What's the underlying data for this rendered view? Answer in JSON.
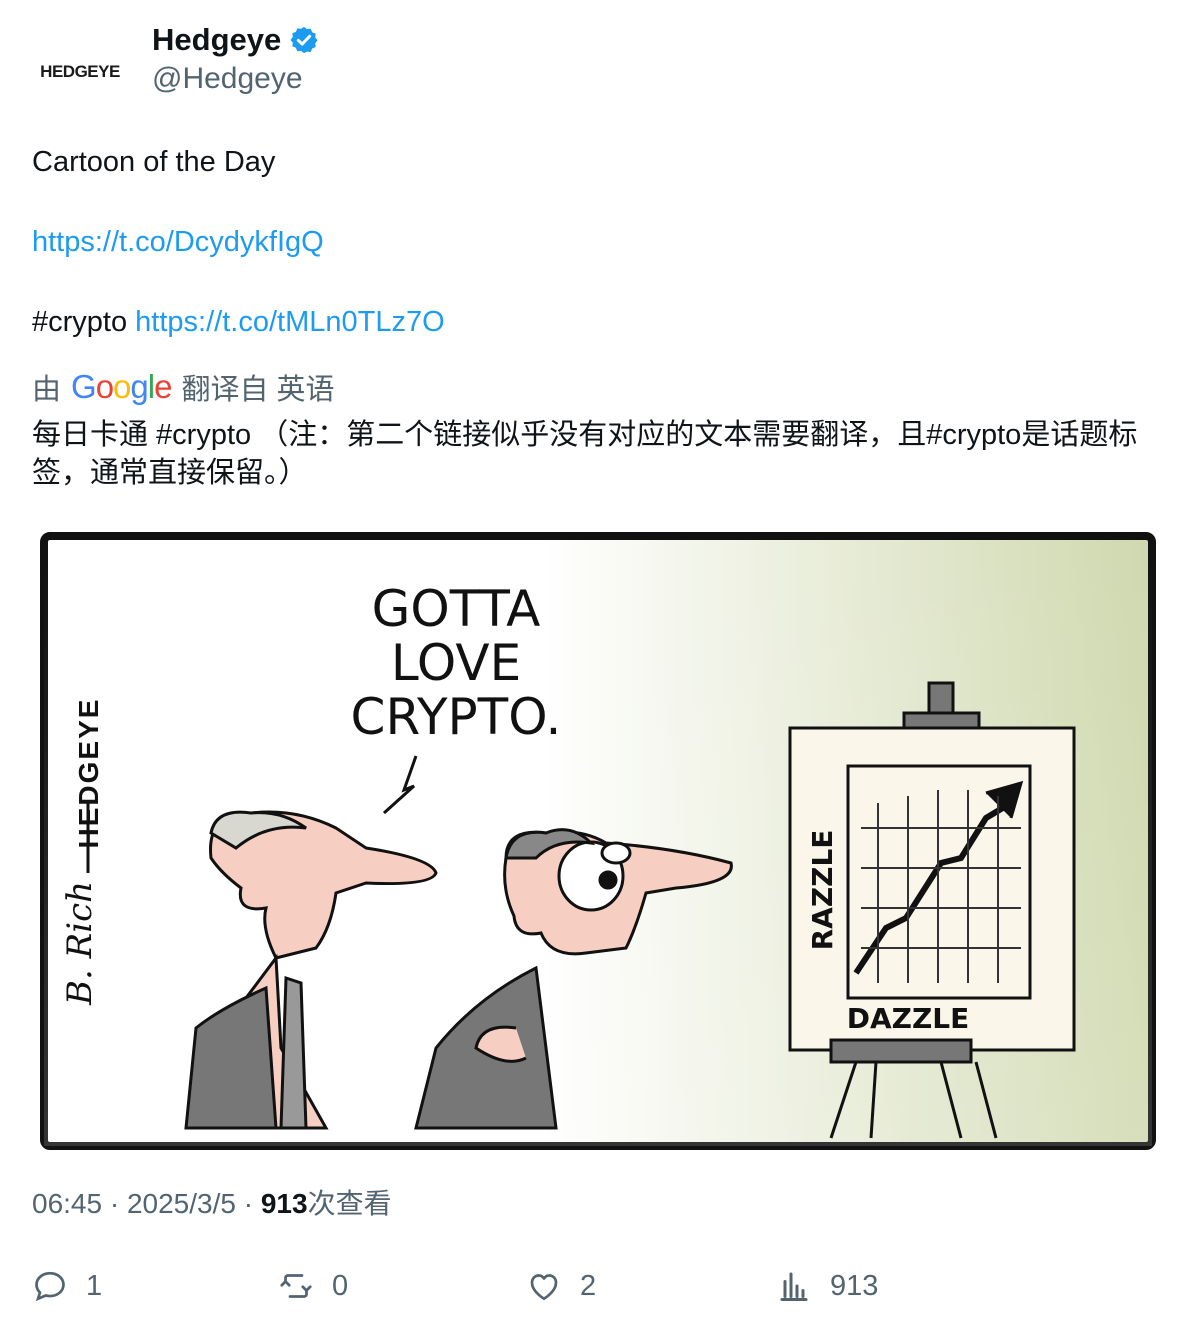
{
  "author": {
    "avatar_text": "HEDGEYE",
    "name": "Hedgeye",
    "handle": "@Hedgeye",
    "verified_color": "#1d9bf0"
  },
  "tweet": {
    "line1": "Cartoon of the Day",
    "link1": "https://t.co/DcydykfIgQ",
    "hashtag": "#crypto",
    "link2": "https://t.co/tMLn0TLz7O"
  },
  "translation": {
    "prefix": "由",
    "provider": "Google",
    "suffix": "翻译自 英语",
    "text": "每日卡通 #crypto （注：第二个链接似乎没有对应的文本需要翻译，且#crypto是话题标签，通常直接保留。）"
  },
  "cartoon": {
    "signature": "HEDGEYE",
    "artist_signature": "B. Rich",
    "speech": [
      "GOTTA",
      "LOVE",
      "CRYPTO."
    ],
    "easel_side": "RAZZLE",
    "easel_bottom": "DAZZLE"
  },
  "meta": {
    "time": "06:45",
    "date": "2025/3/5",
    "views_count": "913",
    "views_label": "次查看"
  },
  "actions": {
    "replies": "1",
    "retweets": "0",
    "likes": "2",
    "views": "913"
  },
  "colors": {
    "link": "#1d9bf0",
    "muted": "#536471",
    "text": "#0f1419"
  }
}
